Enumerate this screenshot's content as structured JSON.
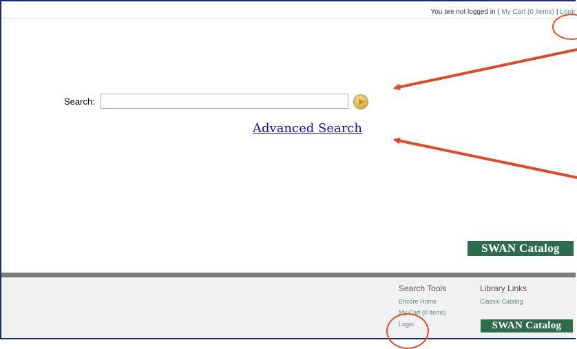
{
  "header": {
    "status_text": "You are not logged in",
    "cart_link": "My Cart (0 items)",
    "login_link": "Login"
  },
  "search": {
    "label": "Search:",
    "value": "",
    "advanced_link": "Advanced Search"
  },
  "brand": {
    "logo_text": "SWAN Catalog",
    "logo_color": "#2f6b4d"
  },
  "footer": {
    "search_tools": {
      "heading": "Search Tools",
      "links": [
        "Encore Home",
        "My Cart (0 items)",
        "Login"
      ]
    },
    "library_links": {
      "heading": "Library Links",
      "links": [
        "Classic Catalog"
      ]
    }
  },
  "annotations": {
    "color": "#e04a2a"
  }
}
